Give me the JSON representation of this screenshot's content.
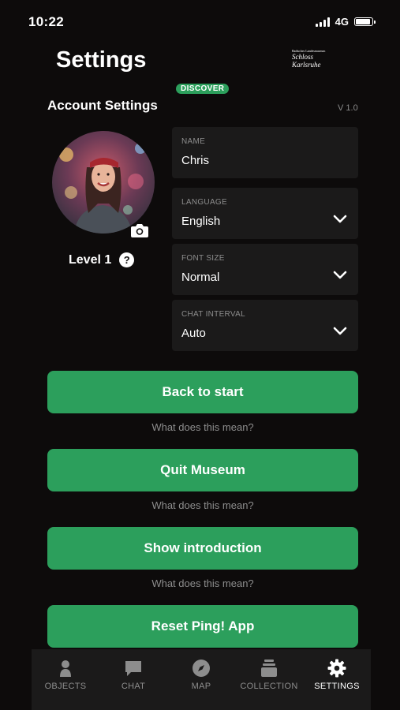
{
  "status_bar": {
    "time": "10:22",
    "network": "4G",
    "battery_level": 0.9
  },
  "header": {
    "title": "Settings",
    "logo": {
      "top_text": "Badisches Landesmuseum",
      "line1": "Schloss",
      "line2": "Karlsruhe"
    },
    "badge": "DISCOVER"
  },
  "account": {
    "section_title": "Account Settings",
    "version": "V 1.0",
    "level_label": "Level 1",
    "help_glyph": "?"
  },
  "fields": {
    "name": {
      "label": "NAME",
      "value": "Chris"
    },
    "language": {
      "label": "LANGUAGE",
      "value": "English"
    },
    "font_size": {
      "label": "FONT SIZE",
      "value": "Normal"
    },
    "chat_interval": {
      "label": "CHAT INTERVAL",
      "value": "Auto"
    }
  },
  "actions": {
    "back_to_start": {
      "label": "Back to start",
      "hint": "What does this mean?"
    },
    "quit_museum": {
      "label": "Quit Museum",
      "hint": "What does this mean?"
    },
    "show_introduction": {
      "label": "Show introduction",
      "hint": "What does this mean?"
    },
    "reset_app": {
      "label": "Reset Ping! App"
    }
  },
  "tabbar": {
    "tabs": [
      {
        "label": "OBJECTS",
        "icon": "person-icon",
        "active": false
      },
      {
        "label": "CHAT",
        "icon": "chat-icon",
        "active": false
      },
      {
        "label": "MAP",
        "icon": "compass-icon",
        "active": false
      },
      {
        "label": "COLLECTION",
        "icon": "stack-icon",
        "active": false
      },
      {
        "label": "SETTINGS",
        "icon": "gear-icon",
        "active": true
      }
    ]
  },
  "colors": {
    "accent": "#2c9f5c",
    "background": "#0d0b0b",
    "field_bg": "#1b1a1a",
    "muted_text": "#8d8d8d"
  }
}
